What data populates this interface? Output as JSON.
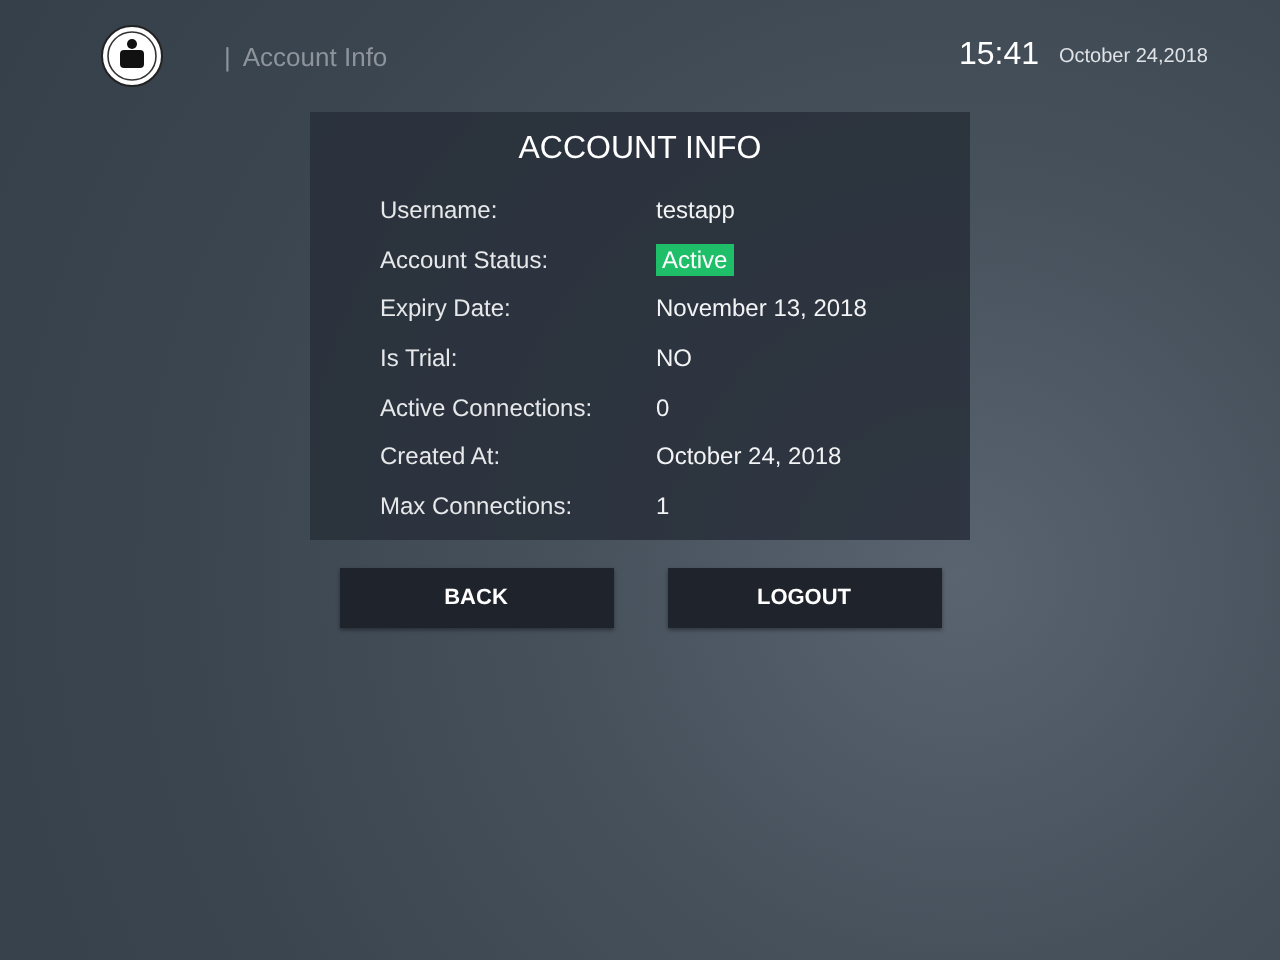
{
  "header": {
    "separator": "|",
    "title": "Account Info",
    "time": "15:41",
    "date": "October 24,2018"
  },
  "card": {
    "title": "ACCOUNT INFO",
    "rows": [
      {
        "label": "Username:",
        "value": "testapp",
        "kind": "text"
      },
      {
        "label": "Account Status:",
        "value": "Active",
        "kind": "badge"
      },
      {
        "label": "Expiry Date:",
        "value": "November 13, 2018",
        "kind": "text"
      },
      {
        "label": "Is Trial:",
        "value": "NO",
        "kind": "text"
      },
      {
        "label": "Active Connections:",
        "value": "0",
        "kind": "text"
      },
      {
        "label": "Created At:",
        "value": "October 24, 2018",
        "kind": "text"
      },
      {
        "label": "Max Connections:",
        "value": "1",
        "kind": "text"
      }
    ]
  },
  "buttons": [
    "BACK",
    "LOGOUT"
  ]
}
